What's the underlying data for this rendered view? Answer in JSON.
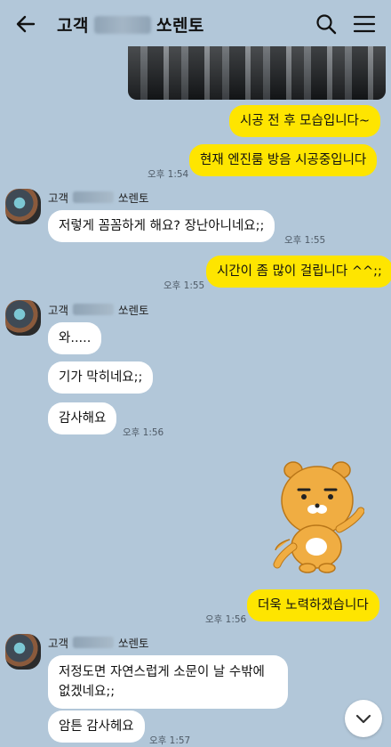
{
  "header": {
    "title_prefix": "고객",
    "title_suffix": "쏘렌토",
    "icons": [
      "back-arrow-icon",
      "search-icon",
      "menu-icon"
    ]
  },
  "colors": {
    "background": "#b2c7d9",
    "my_bubble": "#fee500",
    "their_bubble": "#ffffff"
  },
  "messages": [
    {
      "from": "me",
      "text": "시공 전 후 모습입니다~"
    },
    {
      "from": "me",
      "text": "현재 엔진룸 방음 시공중입니다",
      "time": "오후 1:54"
    },
    {
      "from": "them",
      "sender_prefix": "고객",
      "sender_suffix": "쏘렌토",
      "text": "저렇게 꼼꼼하게 해요? 장난아니네요;;",
      "time": "오후 1:55"
    },
    {
      "from": "me",
      "text": "시간이 좀 많이 걸립니다 ^^;;",
      "time": "오후 1:55"
    },
    {
      "from": "them",
      "sender_prefix": "고객",
      "sender_suffix": "쏘렌토",
      "text": "와....."
    },
    {
      "from": "them",
      "text": "기가 막히네요;;"
    },
    {
      "from": "them",
      "text": "감사해요",
      "time": "오후 1:56"
    },
    {
      "from": "me",
      "emoticon": "ryan-character"
    },
    {
      "from": "me",
      "text": "더욱 노력하겠습니다",
      "time": "오후 1:56"
    },
    {
      "from": "them",
      "sender_prefix": "고객",
      "sender_suffix": "쏘렌토",
      "text": "저정도면 자연스럽게 소문이 날 수밖에 없겠네요;;"
    },
    {
      "from": "them",
      "text": "암튼 감사헤요",
      "time": "오후 1:57"
    }
  ]
}
